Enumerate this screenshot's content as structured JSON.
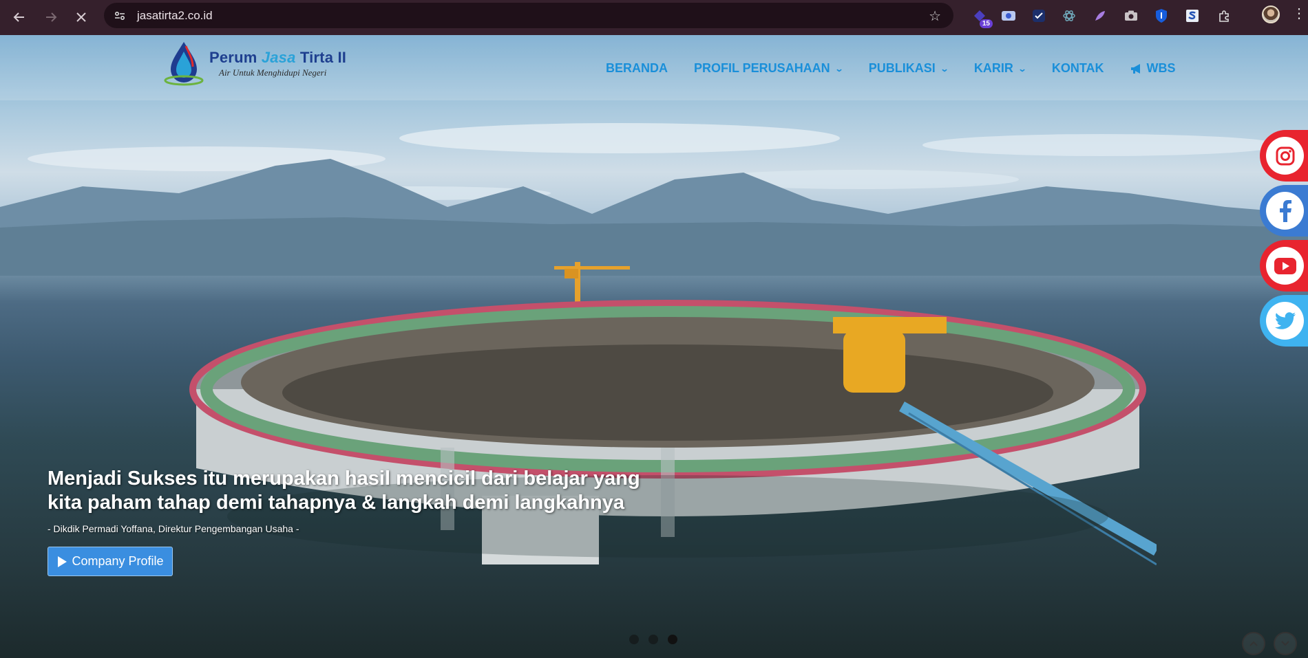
{
  "browser": {
    "url": "jasatirta2.co.id",
    "extension_badge": "15"
  },
  "site": {
    "logo_title_part1": "Perum ",
    "logo_title_accent": "Jasa",
    "logo_title_part2": " Tirta II",
    "logo_tagline": "Air Untuk Menghidupi Negeri"
  },
  "nav": {
    "items": [
      {
        "label": "BERANDA",
        "dropdown": false
      },
      {
        "label": "PROFIL PERUSAHAAN",
        "dropdown": true
      },
      {
        "label": "PUBLIKASI",
        "dropdown": true
      },
      {
        "label": "KARIR",
        "dropdown": true
      },
      {
        "label": "KONTAK",
        "dropdown": false
      },
      {
        "label": "WBS",
        "dropdown": false
      }
    ]
  },
  "hero": {
    "title_line1": "Menjadi Sukses itu merupakan hasil mencicil dari belajar yang",
    "title_line2": "kita paham tahap demi tahapnya & langkah demi langkahnya",
    "quote": "- Dikdik Permadi Yoffana, Direktur Pengembangan Usaha -",
    "cta_label": "Company Profile"
  },
  "social": [
    {
      "name": "instagram",
      "color": "#e8242f"
    },
    {
      "name": "facebook",
      "color": "#3b7bd2"
    },
    {
      "name": "youtube",
      "color": "#e8242f"
    },
    {
      "name": "twitter",
      "color": "#3fb3f0"
    }
  ],
  "carousel": {
    "count": 3,
    "active_index": 2
  },
  "colors": {
    "nav_link": "#1a8fd9",
    "cta": "#3a8ee0",
    "chrome": "#35202c"
  }
}
